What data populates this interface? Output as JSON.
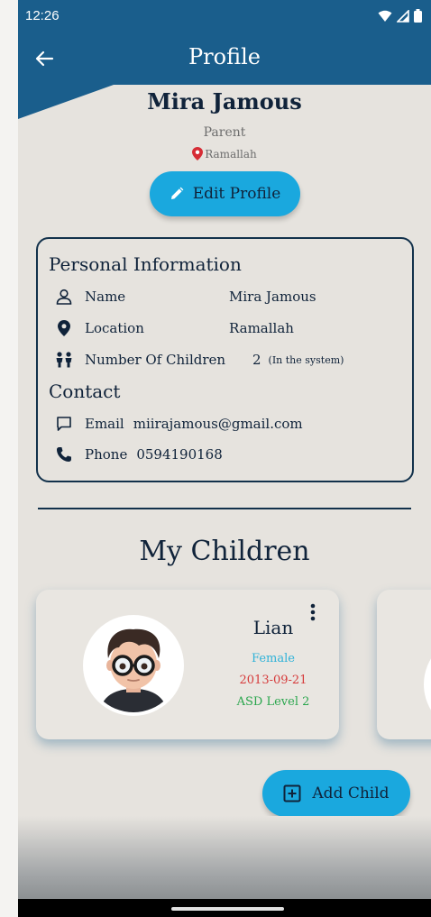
{
  "status": {
    "time": "12:26"
  },
  "appbar": {
    "title": "Profile"
  },
  "profile": {
    "name": "Mira Jamous",
    "role": "Parent",
    "location": "Ramallah",
    "edit_label": "Edit Profile"
  },
  "personal": {
    "heading": "Personal Information",
    "name_label": "Name",
    "name_value": "Mira Jamous",
    "location_label": "Location",
    "location_value": "Ramallah",
    "children_label": "Number Of Children",
    "children_value": "2",
    "children_note": "(In the system)"
  },
  "contact": {
    "heading": "Contact",
    "email_label": "Email",
    "email_value": "miirajamous@gmail.com",
    "phone_label": "Phone",
    "phone_value": "0594190168"
  },
  "children_section": {
    "heading": "My Children",
    "children": [
      {
        "name": "Lian",
        "gender": "Female",
        "dob": "2013-09-21",
        "level": "ASD Level 2"
      }
    ],
    "add_label": "Add Child"
  },
  "colors": {
    "primary": "#1a5e8c",
    "accent": "#1aa8de",
    "background": "#e6e3de",
    "dark_text": "#10233a",
    "gender": "#2fb2d8",
    "dob": "#d63a3a",
    "level": "#2aa64d",
    "location_pin": "#d62c35"
  }
}
